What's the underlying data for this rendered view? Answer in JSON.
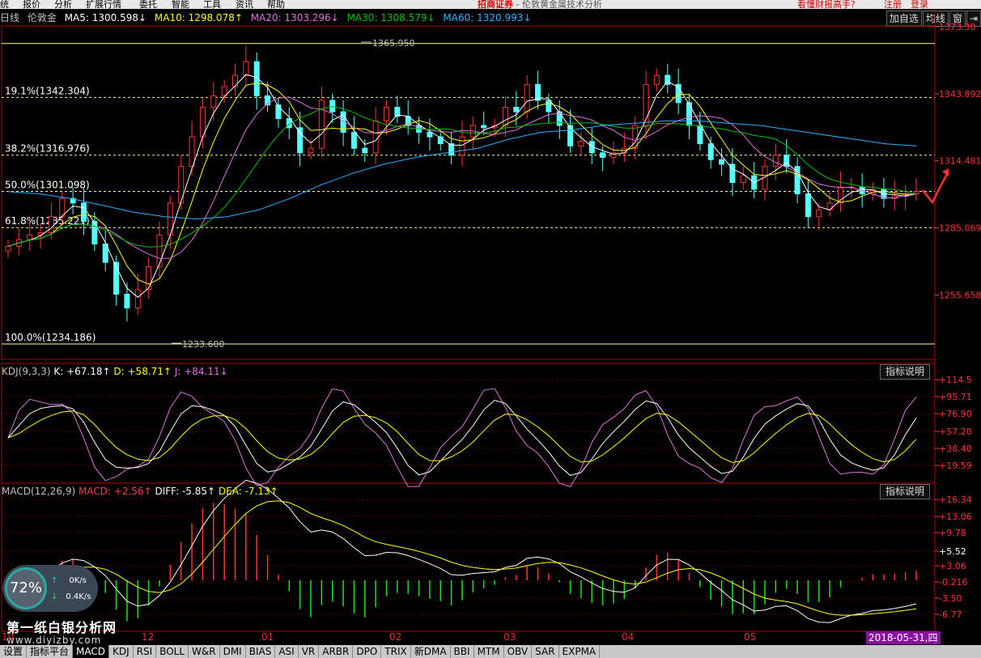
{
  "menubar": {
    "items": [
      "统",
      "报价",
      "分析",
      "扩展行情",
      "委托",
      "智能",
      "工具",
      "资讯",
      "帮助"
    ],
    "brand": "招商证券",
    "center_title": "- 伦敦黄金属技术分析",
    "right": [
      "看懂财报高手?",
      "注册",
      "登录"
    ]
  },
  "header": {
    "period": "日线",
    "instrument": "伦敦金",
    "ma5": "MA5: 1300.598↓",
    "ma10": "MA10: 1298.078↑",
    "ma20": "MA20: 1303.296↓",
    "ma30": "MA30: 1308.579↓",
    "ma60": "MA60: 1320.993↓",
    "buttons": [
      "加自选",
      "均线",
      "窗",
      "⇥"
    ]
  },
  "colors": {
    "ma5": "#ffffff",
    "ma10": "#ffff00",
    "ma20": "#e070e0",
    "ma30": "#00c000",
    "ma60": "#30b0ff",
    "up": "#ff3232",
    "down": "#54ffff",
    "axis": "#ff3232"
  },
  "fib_levels": [
    {
      "label": "",
      "value": 1365.95,
      "style": "solid"
    },
    {
      "label": "19.1%(1342.304)",
      "value": 1342.304,
      "style": "dashed"
    },
    {
      "label": "38.2%(1316.976)",
      "value": 1316.976,
      "style": "dashed"
    },
    {
      "label": "50.0%(1301.098)",
      "value": 1301.098,
      "style": "dashed"
    },
    {
      "label": "61.8%(1285.221)",
      "value": 1285.221,
      "style": "dashed"
    },
    {
      "label": "100.0%(1234.186)",
      "value": 1234.186,
      "style": "solid"
    }
  ],
  "price_annotations": {
    "high": "1365.950",
    "low": "1233.600"
  },
  "price_axis": [
    "1373.30",
    "1343.892",
    "1314.481",
    "1285.069",
    "1255.658"
  ],
  "kdj": {
    "header_name": "KDJ(9,3,3)",
    "k": "K: +67.18↑",
    "d": "D: +58.71↑",
    "j": "J: +84.11↓",
    "axis": [
      "+114.5",
      "+95.71",
      "+76.90",
      "+57.20",
      "+38.40",
      "+19.59"
    ],
    "explain": "指标说明"
  },
  "macd": {
    "header_name": "MACD(12,26,9)",
    "macd": "MACD: +2.56↑",
    "diff": "DIFF: -5.85↑",
    "dea": "DEA: -7.13↑",
    "axis": [
      "+16.34",
      "+13.06",
      "+9.78",
      "+5.52",
      "+3.06",
      "-0.216",
      "-3.50",
      "-6.77"
    ],
    "explain": "指标说明"
  },
  "months": [
    "10",
    "12",
    "01",
    "02",
    "03",
    "04",
    "05"
  ],
  "current_date": "2018-05-31,四",
  "gauge": {
    "percent": "72%",
    "up_speed": "0K/s",
    "down_speed": "0.4K/s"
  },
  "watermark": {
    "title": "第一纸白银分析网",
    "url": "www.diyizby.com"
  },
  "tabs": [
    "设置",
    "指标平台",
    "MACD",
    "KDJ",
    "RSI",
    "BOLL",
    "W&R",
    "DMI",
    "BIAS",
    "ASI",
    "VR",
    "ARBR",
    "DPO",
    "TRIX",
    "新DMA",
    "BBI",
    "MTM",
    "OBV",
    "SAR",
    "EXPMA"
  ],
  "active_tab": "MACD",
  "chart_data": {
    "type": "candlestick",
    "x_range": [
      "2017-10",
      "2018-05-31"
    ],
    "ylim": [
      1234.186,
      1373.3
    ],
    "ma_series": [
      {
        "name": "MA5",
        "end": 1300.598
      },
      {
        "name": "MA10",
        "end": 1298.078
      },
      {
        "name": "MA20",
        "end": 1303.296
      },
      {
        "name": "MA30",
        "end": 1308.579
      },
      {
        "name": "MA60",
        "end": 1320.993
      }
    ],
    "ma60_path": [
      1301,
      1300,
      1298,
      1295,
      1292,
      1290,
      1289,
      1290,
      1293,
      1298,
      1304,
      1309,
      1313,
      1316,
      1318,
      1320,
      1324,
      1327,
      1328,
      1330,
      1331,
      1332,
      1332,
      1331,
      1330,
      1328,
      1326,
      1324,
      1322,
      1321
    ],
    "close_path": [
      1277,
      1280,
      1282,
      1283,
      1290,
      1298,
      1296,
      1288,
      1278,
      1270,
      1256,
      1250,
      1258,
      1268,
      1282,
      1296,
      1312,
      1325,
      1338,
      1343,
      1347,
      1352,
      1358,
      1343,
      1339,
      1333,
      1329,
      1318,
      1320,
      1341,
      1336,
      1327,
      1320,
      1318,
      1332,
      1338,
      1334,
      1330,
      1327,
      1325,
      1322,
      1317,
      1325,
      1330,
      1329,
      1330,
      1338,
      1336,
      1348,
      1341,
      1336,
      1330,
      1321,
      1323,
      1318,
      1316,
      1318,
      1320,
      1330,
      1348,
      1352,
      1348,
      1340,
      1330,
      1322,
      1315,
      1313,
      1305,
      1308,
      1302,
      1312,
      1317,
      1312,
      1300,
      1290,
      1293,
      1296,
      1303,
      1303,
      1300,
      1302,
      1298,
      1299,
      1300,
      1301
    ]
  }
}
